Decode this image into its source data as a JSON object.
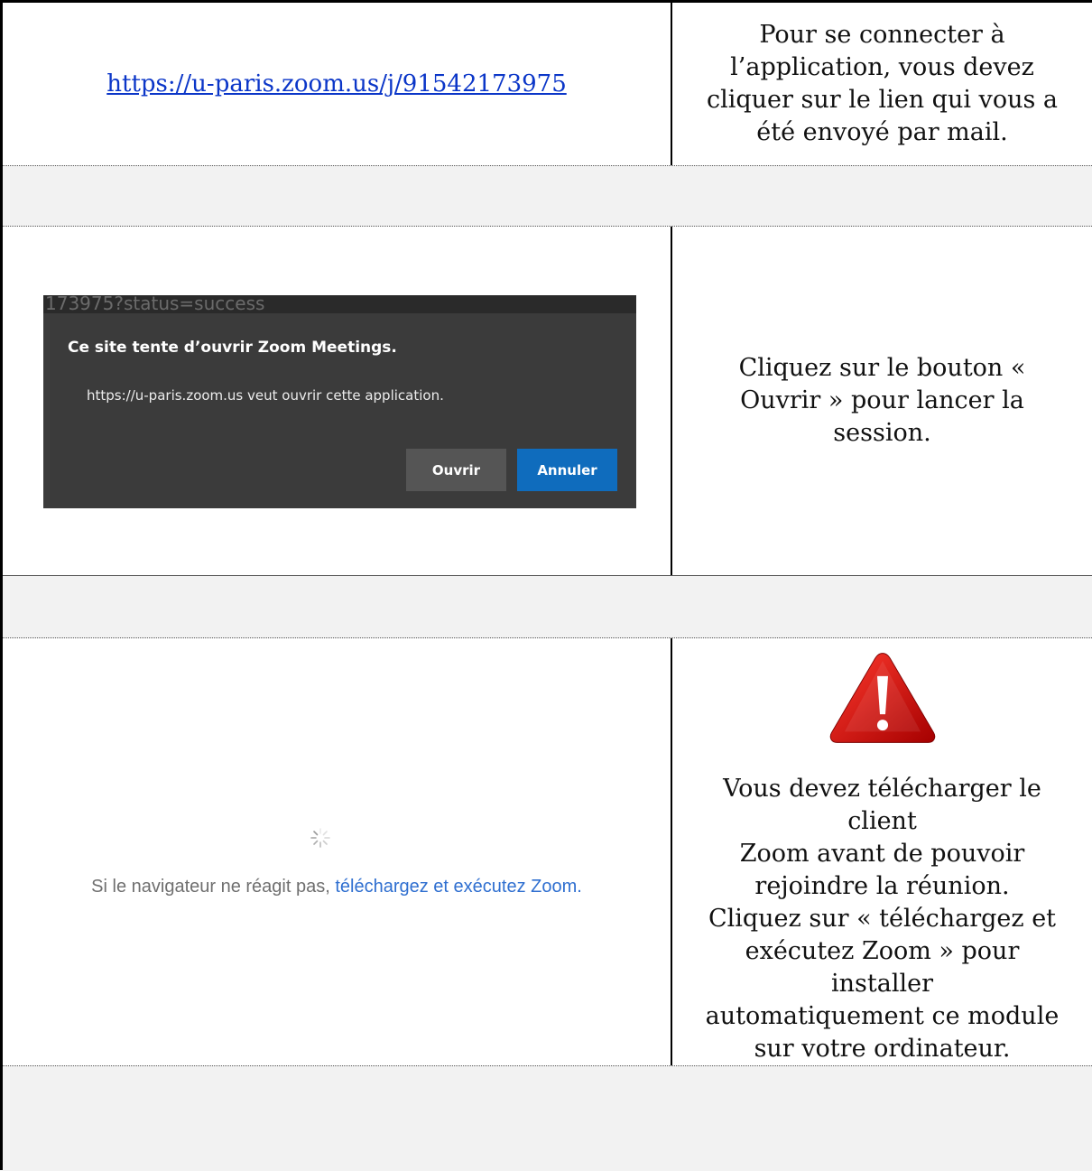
{
  "row1": {
    "link_text": "https://u-paris.zoom.us/j/91542173975",
    "instruction": "Pour se connecter à l’application, vous devez cliquer sur le lien qui vous a été envoyé par mail."
  },
  "row2": {
    "prompt": {
      "url_fragment": "173975?status=success",
      "title": "Ce site tente d’ouvrir Zoom Meetings.",
      "message": "https://u-paris.zoom.us veut ouvrir cette application.",
      "open_label": "Ouvrir",
      "cancel_label": "Annuler"
    },
    "instruction": "Cliquez sur le bouton « Ouvrir » pour lancer la session."
  },
  "row3": {
    "loading_text": "Si le navigateur ne réagit pas, ",
    "loading_link": "téléchargez et exécutez Zoom",
    "loading_after": ".",
    "warning_icon": "warning-triangle-icon",
    "instruction_lines": [
      "Vous devez télécharger le client",
      "Zoom avant de pouvoir",
      "rejoindre la réunion.",
      "Cliquez sur « téléchargez et",
      "exécutez Zoom » pour installer",
      "automatiquement ce module",
      "sur votre ordinateur."
    ]
  },
  "colors": {
    "link": "#0b36c8",
    "prompt_bg": "#3b3b3b",
    "cancel_button": "#0f6cbd",
    "warning_red": "#c40000"
  }
}
